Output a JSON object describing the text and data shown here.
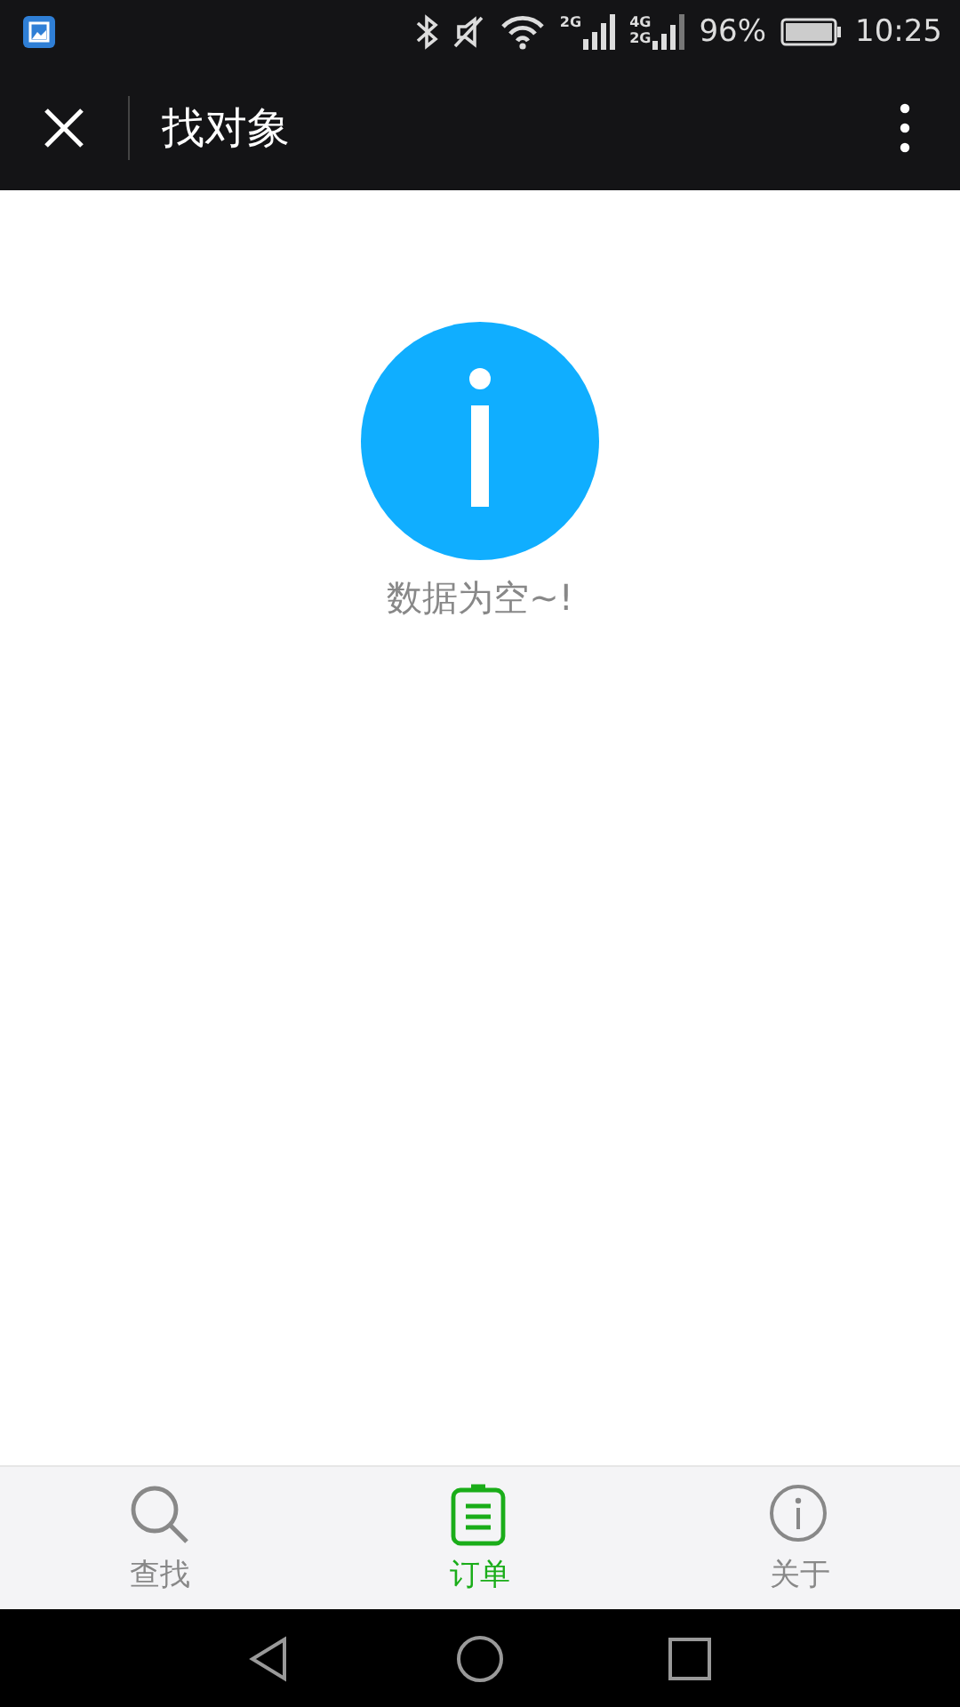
{
  "status_bar": {
    "network_labels": [
      "2G",
      "4G",
      "2G"
    ],
    "battery": "96%",
    "time": "10:25"
  },
  "title_bar": {
    "title": "找对象"
  },
  "empty_state": {
    "message": "数据为空~!"
  },
  "tabs": [
    {
      "label": "查找",
      "kind": "search",
      "selected": false
    },
    {
      "label": "订单",
      "kind": "order",
      "selected": true
    },
    {
      "label": "关于",
      "kind": "info",
      "selected": false
    }
  ]
}
